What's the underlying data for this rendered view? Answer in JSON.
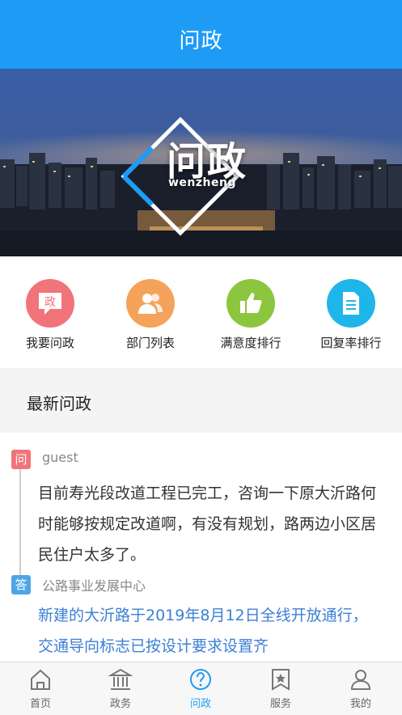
{
  "header": {
    "title": "问政"
  },
  "banner": {
    "logo_text": "问政",
    "logo_subtext": "wenzheng"
  },
  "quick_actions": [
    {
      "label": "我要问政",
      "icon": "ask-icon",
      "color": "#f0747a",
      "icon_text": "政"
    },
    {
      "label": "部门列表",
      "icon": "people-icon",
      "color": "#f5a25a"
    },
    {
      "label": "满意度排行",
      "icon": "thumbs-up-icon",
      "color": "#8cc63f"
    },
    {
      "label": "回复率排行",
      "icon": "document-icon",
      "color": "#1eb6e8"
    }
  ],
  "section": {
    "title": "最新问政"
  },
  "qa_item": {
    "q_badge": "问",
    "asker": "guest",
    "question": "目前寿光段改道工程已完工，咨询一下原大沂路何时能够按规定改道啊，有没有规划，路两边小区居民住户太多了。",
    "a_badge": "答",
    "department": "公路事业发展中心",
    "answer": "新建的大沂路于2019年8月12日全线开放通行，交通导向标志已按设计要求设置齐"
  },
  "tabbar": {
    "items": [
      {
        "label": "首页",
        "icon": "home-icon",
        "active": false
      },
      {
        "label": "政务",
        "icon": "government-icon",
        "active": false
      },
      {
        "label": "问政",
        "icon": "question-icon",
        "active": true
      },
      {
        "label": "服务",
        "icon": "star-bookmark-icon",
        "active": false
      },
      {
        "label": "我的",
        "icon": "user-icon",
        "active": false
      }
    ],
    "active_color": "#1e9cf5"
  }
}
